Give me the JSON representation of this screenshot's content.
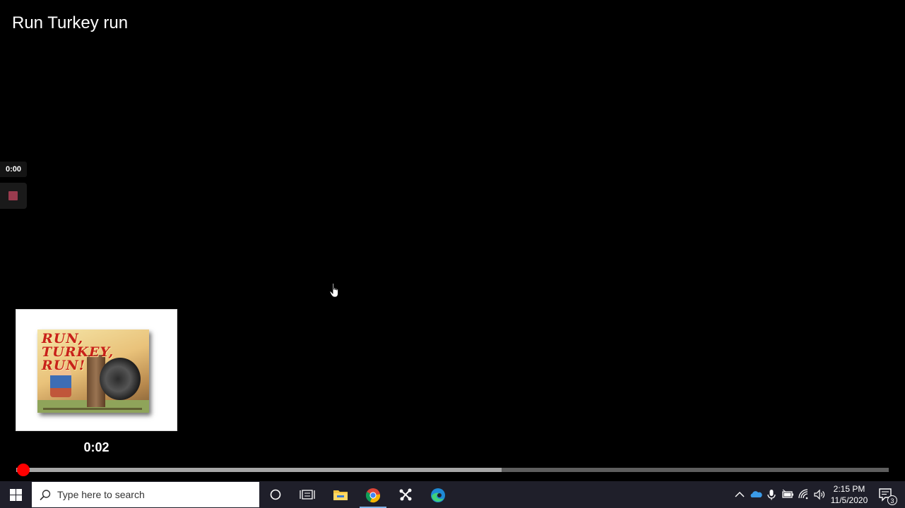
{
  "player": {
    "title": "Run Turkey run",
    "side_time": "0:00",
    "preview_time": "0:02",
    "book_cover_title": "RUN, TURKEY, RUN!",
    "progress": {
      "played_fraction": 0.0,
      "buffered_fraction": 0.556
    }
  },
  "taskbar": {
    "search_placeholder": "Type here to search",
    "apps": [
      {
        "name": "cortana",
        "icon": "circle-icon"
      },
      {
        "name": "task-view",
        "icon": "task-view-icon"
      },
      {
        "name": "file-explorer",
        "icon": "folder-icon"
      },
      {
        "name": "chrome",
        "icon": "chrome-icon",
        "active": true
      },
      {
        "name": "network-app",
        "icon": "nodes-icon"
      },
      {
        "name": "edge",
        "icon": "edge-icon"
      }
    ],
    "tray": [
      "chevron-up-icon",
      "onedrive-icon",
      "microphone-icon",
      "battery-icon",
      "wifi-icon",
      "volume-icon"
    ],
    "clock": {
      "time": "2:15 PM",
      "date": "11/5/2020"
    },
    "notification_count": "3"
  },
  "colors": {
    "accent_red": "#ff0000",
    "taskbar_bg": "#1f1f2a",
    "stop_button": "#9a3b4e"
  }
}
